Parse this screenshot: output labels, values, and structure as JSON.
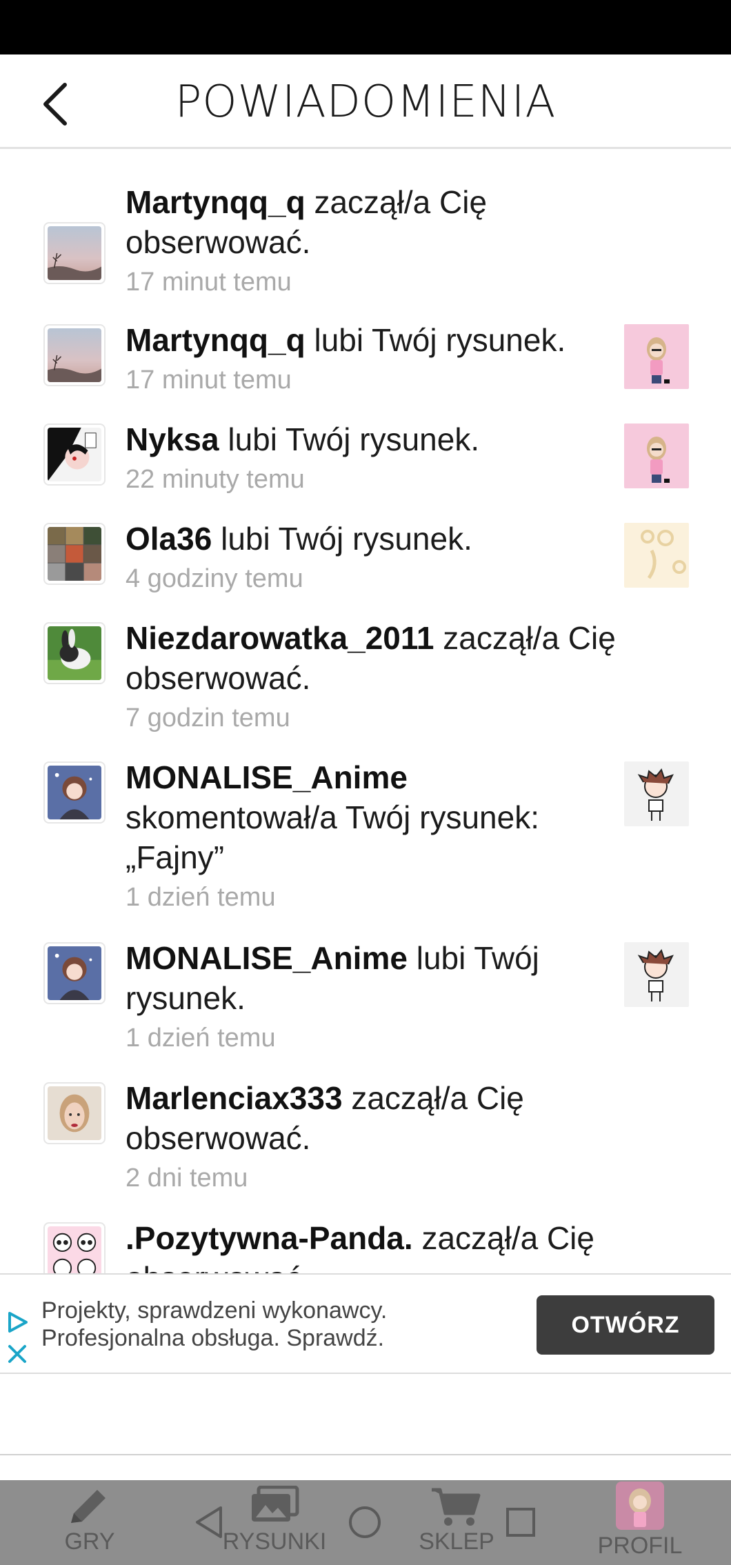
{
  "header": {
    "title": "POWIADOMIENIA"
  },
  "notifications": [
    {
      "user": "Martynqq_q",
      "action": "zaczął/a Cię obserwować.",
      "time": "17 minut temu"
    },
    {
      "user": "Martynqq_q",
      "action": "lubi Twój rysunek.",
      "time": "17 minut temu"
    },
    {
      "user": "Nyksa",
      "action": "lubi Twój rysunek.",
      "time": "22 minuty temu"
    },
    {
      "user": "Ola36",
      "action": "lubi Twój rysunek.",
      "time": "4 godziny temu"
    },
    {
      "user": "Niezdarowatka_2011",
      "action": "zaczął/a Cię obserwować.",
      "time": "7 godzin temu"
    },
    {
      "user": "MONALISE_Anime",
      "action": "skomentował/a Twój rysunek: „Fajny”",
      "time": "1 dzień temu"
    },
    {
      "user": "MONALISE_Anime",
      "action": "lubi Twój rysunek.",
      "time": "1 dzień temu"
    },
    {
      "user": "Marlenciax333",
      "action": "zaczął/a Cię obserwować.",
      "time": "2 dni temu"
    },
    {
      "user": ".Pozytywna-Panda.",
      "action": "zaczął/a Cię obserwować.",
      "time": ""
    }
  ],
  "ad": {
    "line1": "Projekty, sprawdzeni wykonawcy.",
    "line2": "Profesjonalna obsługa. Sprawdź.",
    "button": "OTWÓRZ"
  },
  "nav": {
    "games": "GRY",
    "drawings": "RYSUNKI",
    "shop": "SKLEP",
    "profile": "PROFIL"
  },
  "colors": {
    "status_bar": "#000000",
    "nav_bg": "#8e8e8e",
    "ad_button": "#3d3d3d",
    "time_text": "#a9a9a9"
  }
}
